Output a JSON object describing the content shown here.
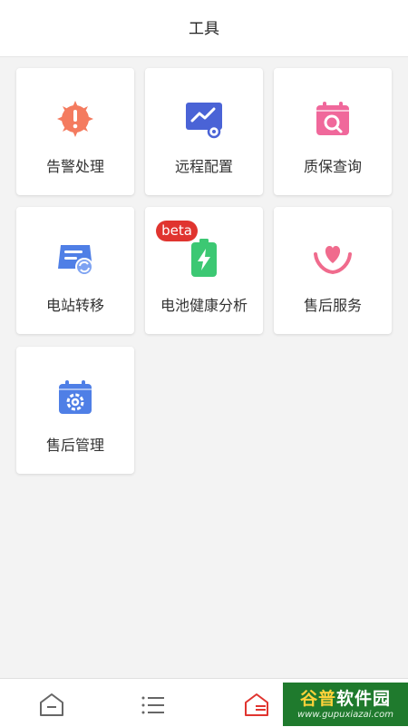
{
  "header": {
    "title": "工具"
  },
  "tools": [
    {
      "label": "告警处理",
      "icon": "alarm-icon",
      "color": "#f47b5f"
    },
    {
      "label": "远程配置",
      "icon": "remote-config-icon",
      "color": "#4a63d6"
    },
    {
      "label": "质保查询",
      "icon": "warranty-query-icon",
      "color": "#f0689b"
    },
    {
      "label": "电站转移",
      "icon": "station-transfer-icon",
      "color": "#4f7fe6"
    },
    {
      "label": "电池健康分析",
      "icon": "battery-icon",
      "color": "#3cc873",
      "badge": "beta"
    },
    {
      "label": "售后服务",
      "icon": "after-sales-service-icon",
      "color": "#f06b8d"
    },
    {
      "label": "售后管理",
      "icon": "after-sales-manage-icon",
      "color": "#4f7fe6"
    }
  ],
  "tabbar": {
    "items": [
      {
        "icon": "home-icon",
        "active": false
      },
      {
        "icon": "list-icon",
        "active": false
      },
      {
        "icon": "tools-icon",
        "active": true
      }
    ],
    "active_color": "#e0342f"
  },
  "watermark": {
    "text_a": "谷普",
    "text_b": "软件园",
    "url": "www.gupuxiazai.com"
  }
}
